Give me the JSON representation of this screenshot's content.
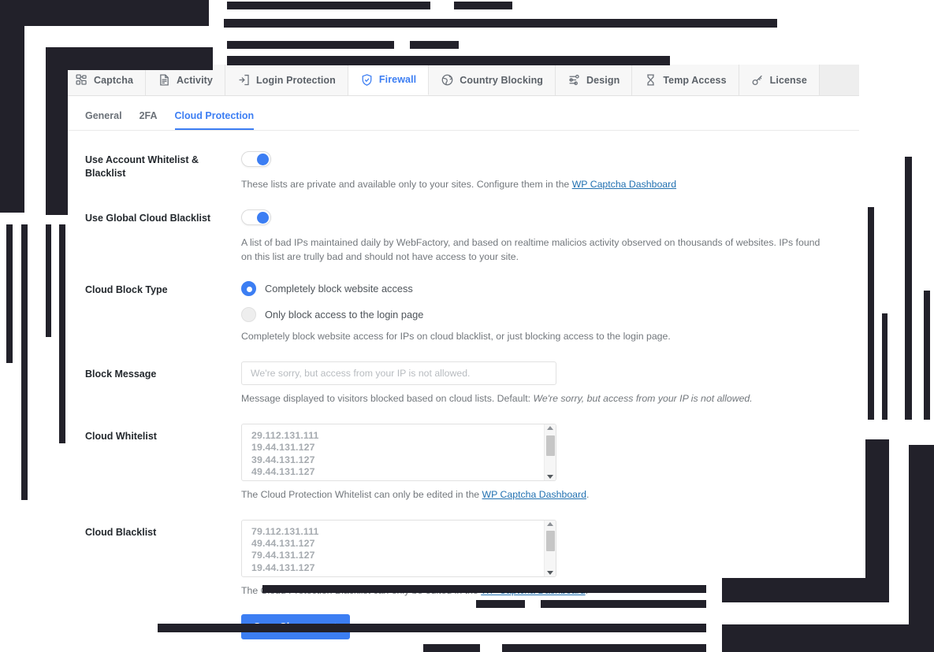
{
  "tabs": [
    {
      "label": "Captcha",
      "icon": "captcha-icon",
      "active": false
    },
    {
      "label": "Activity",
      "icon": "activity-document-icon",
      "active": false
    },
    {
      "label": "Login Protection",
      "icon": "login-door-icon",
      "active": false
    },
    {
      "label": "Firewall",
      "icon": "shield-check-icon",
      "active": true
    },
    {
      "label": "Country Blocking",
      "icon": "globe-icon",
      "active": false
    },
    {
      "label": "Design",
      "icon": "sliders-icon",
      "active": false
    },
    {
      "label": "Temp Access",
      "icon": "hourglass-icon",
      "active": false
    },
    {
      "label": "License",
      "icon": "key-icon",
      "active": false
    }
  ],
  "subtabs": [
    {
      "label": "General",
      "active": false
    },
    {
      "label": "2FA",
      "active": false
    },
    {
      "label": "Cloud Protection",
      "active": true
    }
  ],
  "fields": {
    "account_list": {
      "label": "Use Account Whitelist & Blacklist",
      "toggle_on": true,
      "help_before": "These lists are private and available only to your sites. Configure them in the ",
      "help_link": "WP Captcha Dashboard",
      "help_after": ""
    },
    "global_blacklist": {
      "label": "Use Global Cloud Blacklist",
      "toggle_on": true,
      "help": "A list of bad IPs maintained daily by WebFactory, and based on realtime malicios activity observed on thousands of websites. IPs found on this list are trully bad and should not have access to your site."
    },
    "block_type": {
      "label": "Cloud Block Type",
      "options": [
        {
          "label": "Completely block website access",
          "selected": true
        },
        {
          "label": "Only block access to the login page",
          "selected": false
        }
      ],
      "help": "Completely block website access for IPs on cloud blacklist, or just blocking access to the login page."
    },
    "block_message": {
      "label": "Block Message",
      "value": "",
      "placeholder": "We're sorry, but access from your IP is not allowed.",
      "help_before": "Message displayed to visitors blocked based on cloud lists. Default: ",
      "help_italic": "We're sorry, but access from your IP is not allowed."
    },
    "cloud_whitelist": {
      "label": "Cloud Whitelist",
      "lines": [
        "29.112.131.111",
        "19.44.131.127",
        "39.44.131.127",
        "49.44.131.127"
      ],
      "help_before": "The Cloud Protection Whitelist can only be edited in the ",
      "help_link": "WP Captcha Dashboard",
      "help_after": "."
    },
    "cloud_blacklist": {
      "label": "Cloud Blacklist",
      "lines": [
        "79.112.131.111",
        "49.44.131.127",
        "79.44.131.127",
        "19.44.131.127"
      ],
      "help_before": "The Cloud Protection Blacklist can only be edited in the ",
      "help_link": "WP Captcha Dashboard",
      "help_after": "."
    }
  },
  "save": {
    "label": "Save Changes",
    "check": "✓"
  },
  "colors": {
    "accent": "#3c7ef3",
    "link": "#2271b1",
    "label": "#23282d",
    "muted": "#72777c",
    "occlusion": "#22212a"
  }
}
